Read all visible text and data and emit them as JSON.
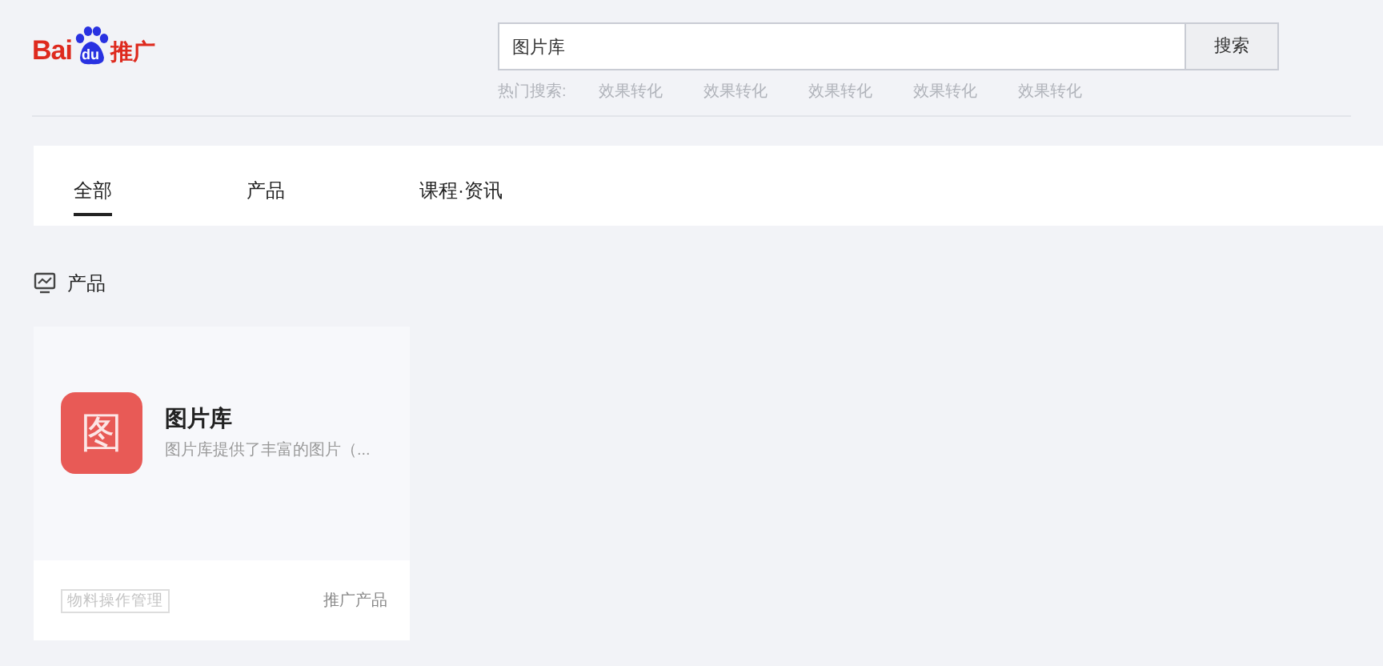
{
  "logo": {
    "text": "Bai",
    "paw_text": "du",
    "suffix": "推广"
  },
  "search": {
    "value": "图片库",
    "button": "搜索"
  },
  "hot_search": {
    "label": "热门搜索:",
    "items": [
      "效果转化",
      "效果转化",
      "效果转化",
      "效果转化",
      "效果转化"
    ]
  },
  "tabs": [
    {
      "label": "全部",
      "selected": true
    },
    {
      "label": "产品",
      "selected": false
    },
    {
      "label": "课程·资讯",
      "selected": false
    }
  ],
  "section": {
    "title": "产品"
  },
  "cards": [
    {
      "icon_glyph": "图",
      "title": "图片库",
      "description": "图片库提供了丰富的图片（...",
      "tag": "物料操作管理",
      "category": "推广产品"
    }
  ]
}
